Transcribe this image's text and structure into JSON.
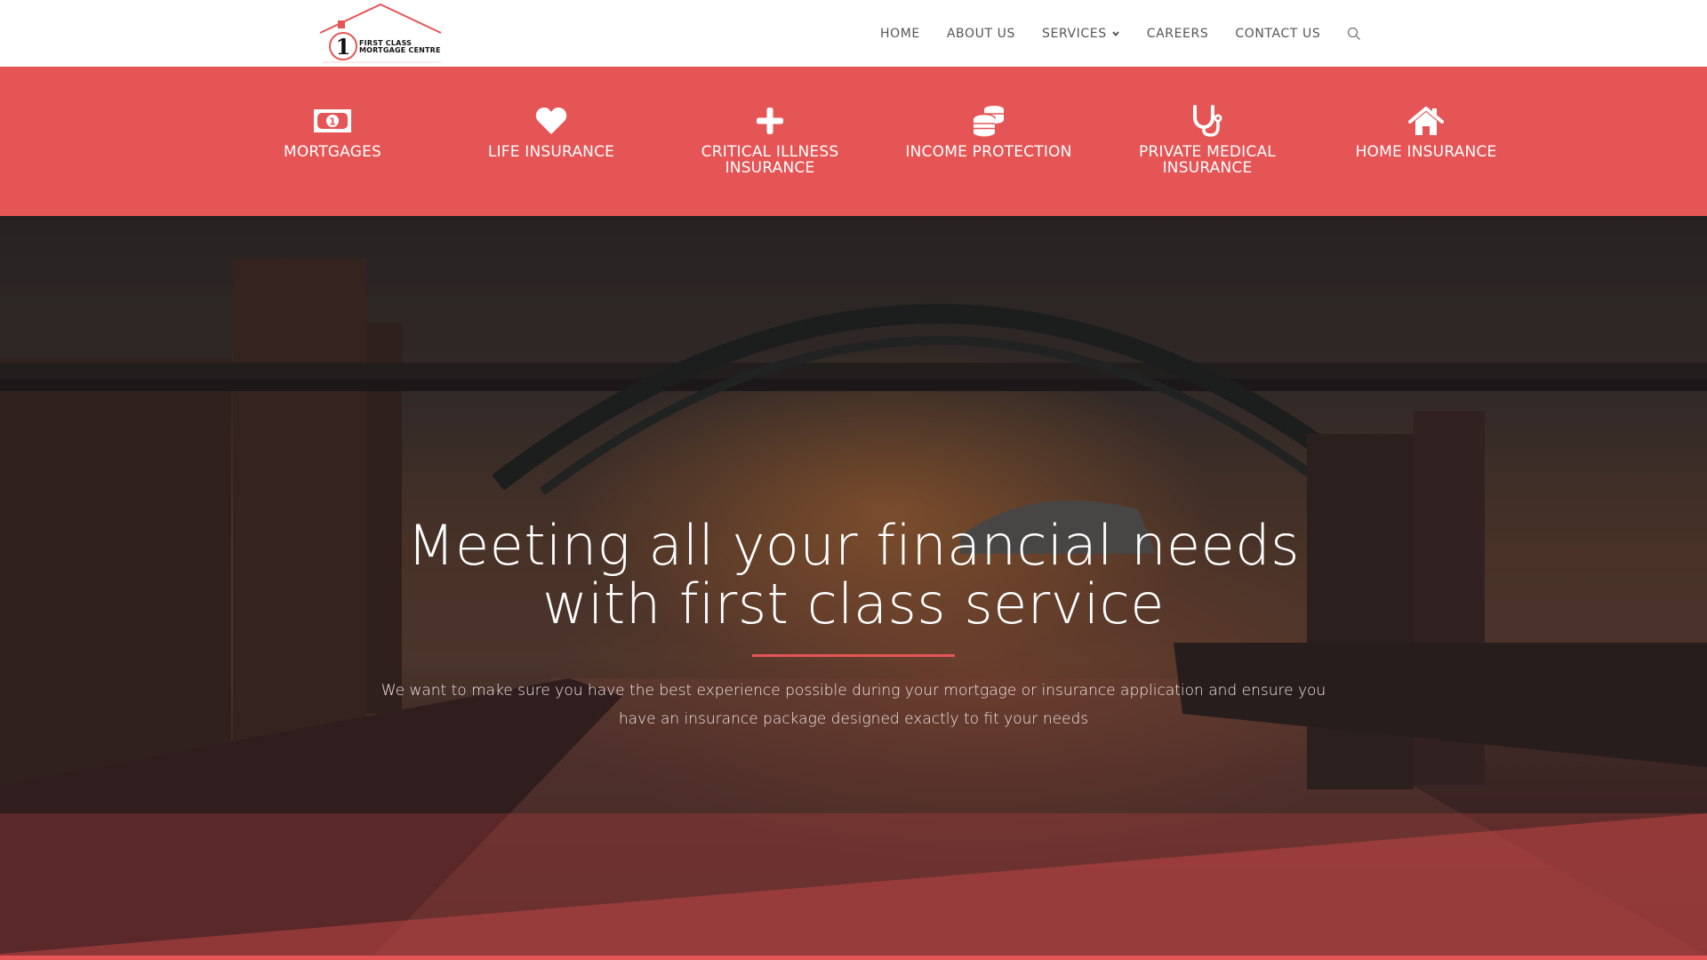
{
  "brand": {
    "name_line1": "FIRST CLASS",
    "name_line2": "MORTGAGE CENTRE",
    "logo_numeral": "1",
    "accent_color": "#e65556"
  },
  "nav": {
    "items": [
      {
        "label": "HOME"
      },
      {
        "label": "ABOUT US"
      },
      {
        "label": "SERVICES",
        "has_dropdown": true
      },
      {
        "label": "CAREERS"
      },
      {
        "label": "CONTACT US"
      }
    ],
    "search_icon": "search-icon"
  },
  "services": [
    {
      "label": "MORTGAGES",
      "icon": "banknote-icon"
    },
    {
      "label": "LIFE INSURANCE",
      "icon": "heart-icon"
    },
    {
      "label": "CRITICAL ILLNESS INSURANCE",
      "icon": "plus-icon"
    },
    {
      "label": "INCOME PROTECTION",
      "icon": "coins-icon"
    },
    {
      "label": "PRIVATE MEDICAL INSURANCE",
      "icon": "stethoscope-icon"
    },
    {
      "label": "HOME INSURANCE",
      "icon": "home-icon"
    }
  ],
  "hero": {
    "title_line1": "Meeting all your financial needs",
    "title_line2": "with first class service",
    "subtitle_line1": "We want to make sure you have the best experience possible during your mortgage or insurance application and ensure you",
    "subtitle_line2": "have an insurance package designed exactly to fit your needs",
    "background": "Tyne Bridge at sunset"
  }
}
